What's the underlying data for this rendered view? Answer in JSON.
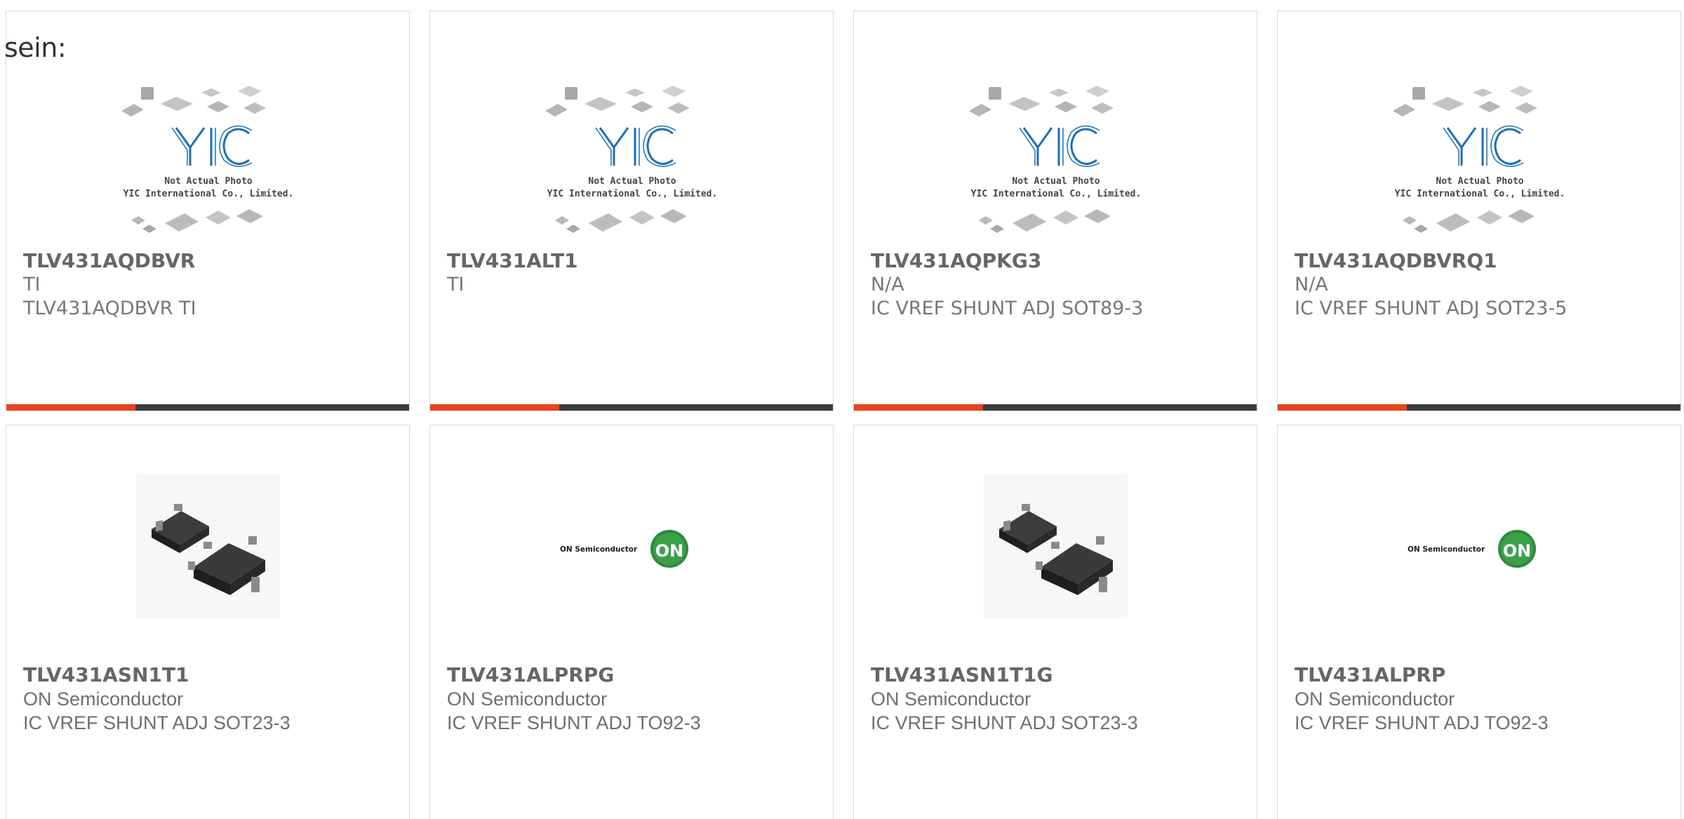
{
  "leadin": "sein:",
  "placeholder": {
    "logo": "YIC",
    "line1": "Not Actual Photo",
    "line2": "YIC International Co., Limited."
  },
  "on_logo": {
    "wordmark": "ON Semiconductor",
    "badge": "ON"
  },
  "colors": {
    "accent": "#e8421b",
    "bar": "#3b3b3b",
    "logo_blue": "#1b6fb3",
    "on_green": "#2e8b3c"
  },
  "products": [
    {
      "part": "TLV431AQDBVR",
      "manufacturer": "TI",
      "description": "TLV431AQDBVR TI",
      "image": "placeholder"
    },
    {
      "part": "TLV431ALT1",
      "manufacturer": "TI",
      "description": "",
      "image": "placeholder"
    },
    {
      "part": "TLV431AQPKG3",
      "manufacturer": "N/A",
      "description": "IC VREF SHUNT ADJ SOT89-3",
      "image": "placeholder"
    },
    {
      "part": "TLV431AQDBVRQ1",
      "manufacturer": "N/A",
      "description": "IC VREF SHUNT ADJ SOT23-5",
      "image": "placeholder"
    },
    {
      "part": "TLV431ASN1T1",
      "manufacturer": "ON Semiconductor",
      "description": "IC VREF SHUNT ADJ SOT23-3",
      "image": "sot23-photo"
    },
    {
      "part": "TLV431ALPRPG",
      "manufacturer": "ON Semiconductor",
      "description": "IC VREF SHUNT ADJ TO92-3",
      "image": "on-logo"
    },
    {
      "part": "TLV431ASN1T1G",
      "manufacturer": "ON Semiconductor",
      "description": "IC VREF SHUNT ADJ SOT23-3",
      "image": "sot23-photo"
    },
    {
      "part": "TLV431ALPRP",
      "manufacturer": "ON Semiconductor",
      "description": "IC VREF SHUNT ADJ TO92-3",
      "image": "on-logo"
    }
  ]
}
